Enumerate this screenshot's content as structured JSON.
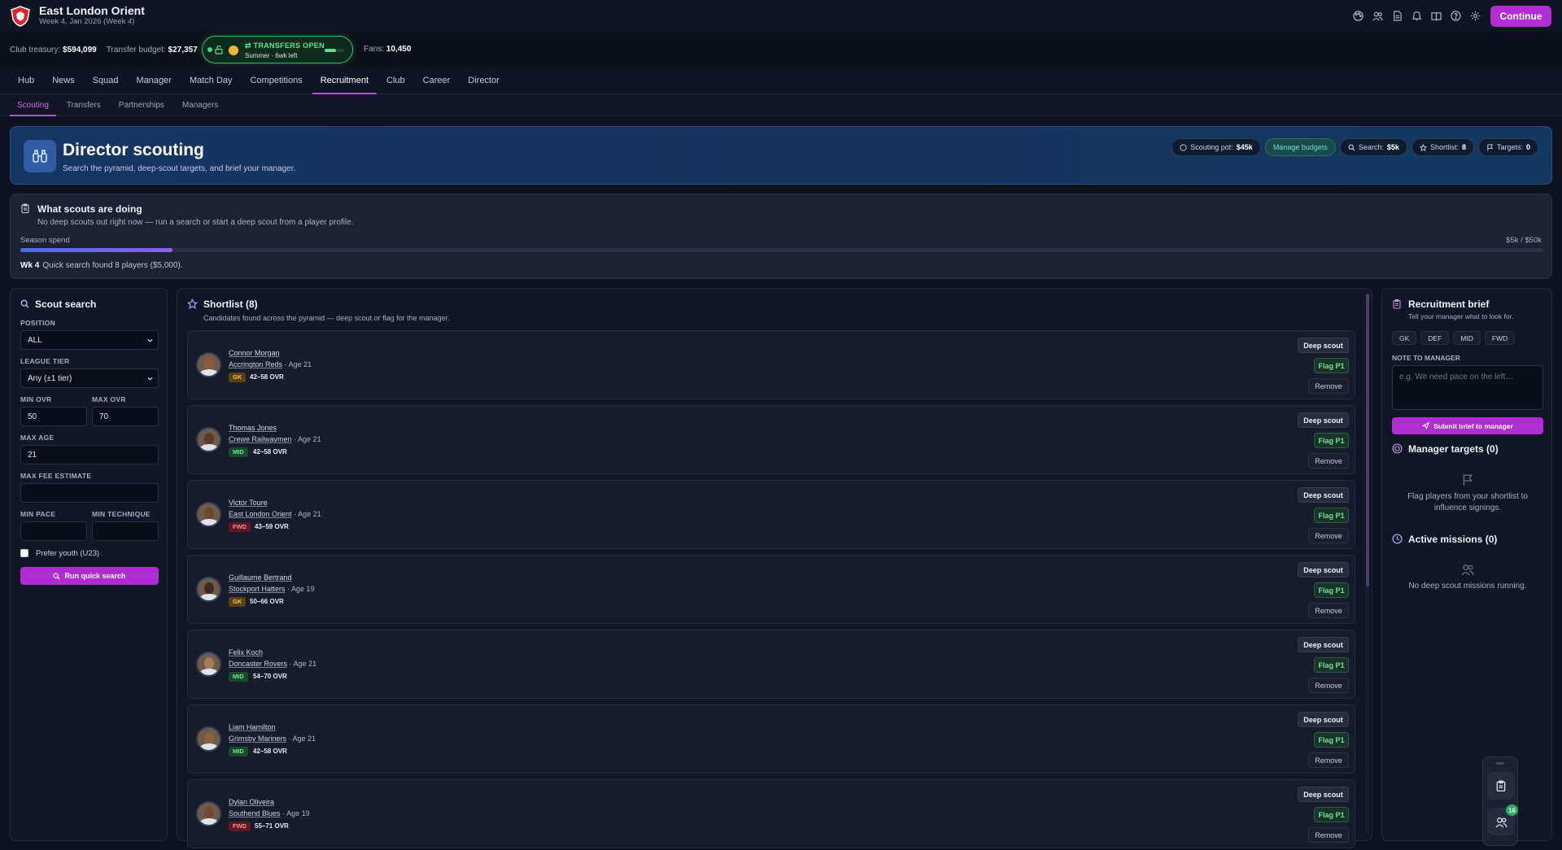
{
  "header": {
    "club_name": "East London Orient",
    "club_sub": "Week 4, Jan 2026 (Week 4)",
    "icons": [
      "palette-icon",
      "people-icon",
      "document-icon",
      "bell-icon",
      "book-icon",
      "help-icon",
      "gear-icon"
    ],
    "continue_label": "Continue"
  },
  "finance": {
    "treasury_label": "Club treasury:",
    "treasury_value": "$594,099",
    "budget_label": "Transfer budget:",
    "budget_value": "$27,357",
    "transfers_title": "TRANSFERS OPEN",
    "transfers_sub": "Summer · 6wk left",
    "transfers_progress": 0.6,
    "fans_label": "Fans:",
    "fans_value": "10,450"
  },
  "nav": {
    "items": [
      "Hub",
      "News",
      "Squad",
      "Manager",
      "Match Day",
      "Competitions",
      "Recruitment",
      "Club",
      "Career",
      "Director"
    ],
    "active": "Recruitment"
  },
  "subnav": {
    "items": [
      "Scouting",
      "Transfers",
      "Partnerships",
      "Managers"
    ],
    "active": "Scouting"
  },
  "hero": {
    "title": "Director scouting",
    "subtitle": "Search the pyramid, deep-scout targets, and brief your manager.",
    "pot_label": "Scouting pot:",
    "pot_value": "$45k",
    "manage_label": "Manage budgets",
    "search_label": "Search:",
    "search_value": "$5k",
    "shortlist_label": "Shortlist:",
    "shortlist_value": "8",
    "targets_label": "Targets:",
    "targets_value": "0"
  },
  "doing": {
    "title": "What scouts are doing",
    "subtitle": "No deep scouts out right now — run a search or start a deep scout from a player profile.",
    "spend_label": "Season spend",
    "spend_value": "$5k / $50k",
    "spend_fraction": 0.1,
    "log_week": "Wk 4",
    "log_text": "Quick search found 8 players ($5,000)."
  },
  "search": {
    "title": "Scout search",
    "position_label": "POSITION",
    "position_value": "ALL",
    "tier_label": "LEAGUE TIER",
    "tier_value": "Any (±1 tier)",
    "min_ovr_label": "MIN OVR",
    "min_ovr_value": "50",
    "max_ovr_label": "MAX OVR",
    "max_ovr_value": "70",
    "max_age_label": "MAX AGE",
    "max_age_value": "21",
    "max_fee_label": "MAX FEE ESTIMATE",
    "max_fee_value": "",
    "min_pace_label": "MIN PACE",
    "min_pace_value": "",
    "min_tech_label": "MIN TECHNIQUE",
    "min_tech_value": "",
    "youth_label": "Prefer youth (U23)",
    "run_label": "Run quick search"
  },
  "shortlist": {
    "title": "Shortlist (8)",
    "subtitle": "Candidates found across the pyramid — deep scout or flag for the manager.",
    "deep_label": "Deep scout",
    "flag_label": "Flag P1",
    "remove_label": "Remove",
    "players": [
      {
        "name": "Connor Morgan",
        "club": "Accrington Reds",
        "age": "· Age 21",
        "pos": "GK",
        "ovr": "42–58 OVR"
      },
      {
        "name": "Thomas Jones",
        "club": "Crewe Railwaymen",
        "age": "· Age 21",
        "pos": "MID",
        "ovr": "42–58 OVR"
      },
      {
        "name": "Victor Toure",
        "club": "East London Orient",
        "age": "· Age 21",
        "pos": "FWD",
        "ovr": "43–59 OVR"
      },
      {
        "name": "Guillaume Bertrand",
        "club": "Stockport Hatters",
        "age": "· Age 19",
        "pos": "GK",
        "ovr": "50–66 OVR"
      },
      {
        "name": "Felix Koch",
        "club": "Doncaster Rovers",
        "age": "· Age 21",
        "pos": "MID",
        "ovr": "54–70 OVR"
      },
      {
        "name": "Liam Hamilton",
        "club": "Grimsby Mariners",
        "age": "· Age 21",
        "pos": "MID",
        "ovr": "42–58 OVR"
      },
      {
        "name": "Dylan Oliveira",
        "club": "Southend Blues",
        "age": "· Age 19",
        "pos": "FWD",
        "ovr": "55–71 OVR"
      }
    ]
  },
  "brief": {
    "title": "Recruitment brief",
    "subtitle": "Tell your manager what to look for.",
    "positions": [
      "GK",
      "DEF",
      "MID",
      "FWD"
    ],
    "note_label": "NOTE TO MANAGER",
    "note_placeholder": "e.g. We need pace on the left…",
    "submit_label": "Submit brief to manager",
    "targets_title": "Manager targets (0)",
    "targets_empty": "Flag players from your shortlist to influence signings.",
    "missions_title": "Active missions (0)",
    "missions_empty": "No deep scout missions running."
  },
  "dock": {
    "badge": "16"
  },
  "colors": {
    "accent": "#b02ed1",
    "green": "#3bbf6a"
  }
}
